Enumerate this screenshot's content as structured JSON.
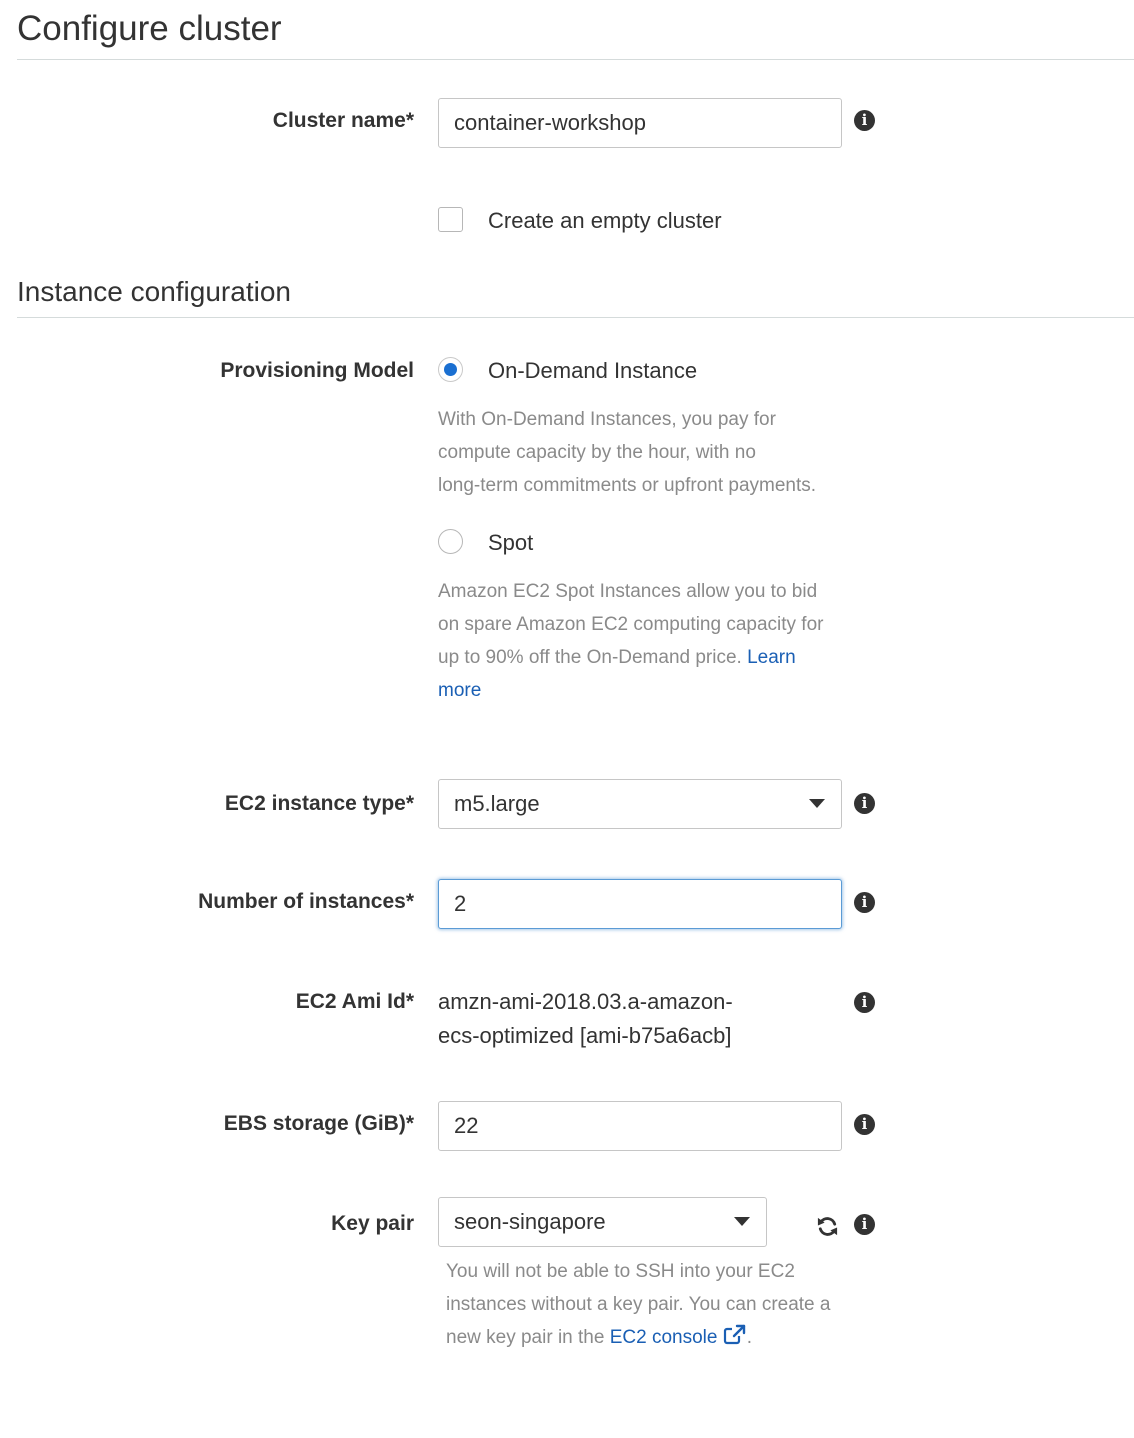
{
  "page": {
    "title": "Configure cluster"
  },
  "cluster": {
    "name_label": "Cluster name*",
    "name_value": "container-workshop",
    "empty_cluster_label": "Create an empty cluster",
    "empty_cluster_checked": false
  },
  "instance_config": {
    "title": "Instance configuration",
    "provisioning": {
      "label": "Provisioning Model",
      "on_demand": {
        "label": "On-Demand Instance",
        "checked": true,
        "description_lines": [
          "With On-Demand Instances, you pay for",
          "compute capacity by the hour, with no",
          "long-term commitments or upfront payments."
        ]
      },
      "spot": {
        "label": "Spot",
        "checked": false,
        "description_lines": [
          "Amazon EC2 Spot Instances allow you to bid",
          "on spare Amazon EC2 computing capacity for",
          "up to 90% off the On-Demand price."
        ],
        "learn": "Learn",
        "more": "more"
      }
    },
    "instance_type": {
      "label": "EC2 instance type*",
      "value": "m5.large"
    },
    "num_instances": {
      "label": "Number of instances*",
      "value": "2"
    },
    "ami": {
      "label": "EC2 Ami Id*",
      "value_line1": "amzn-ami-2018.03.a-amazon-",
      "value_line2": "ecs-optimized [ami-b75a6acb]"
    },
    "ebs": {
      "label": "EBS storage (GiB)*",
      "value": "22"
    },
    "key_pair": {
      "label": "Key pair",
      "value": "seon-singapore",
      "help_line1": "You will not be able to SSH into your EC2",
      "help_line2": "instances without a key pair. You can create a",
      "help_line3_prefix": "new key pair in the ",
      "help_link": "EC2 console",
      "help_suffix": "."
    }
  },
  "icons": {
    "info_glyph": "i"
  },
  "colors": {
    "accent_blue": "#1a6fd1",
    "link_blue": "#1a5fb4",
    "focus_border": "#5b9bd5",
    "text": "#333333",
    "muted_text": "#8a8a8a",
    "divider": "#d5dbdb"
  }
}
